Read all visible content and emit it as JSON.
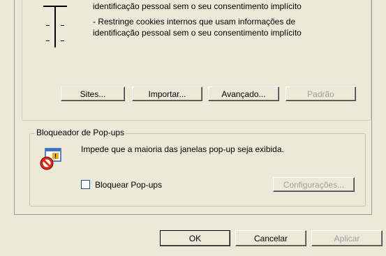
{
  "privacy": {
    "line1": "identificação pessoal sem o seu consentimento implícito",
    "line2": "- Restringe cookies internos que usam informações de",
    "line3": "identificação pessoal sem o seu consentimento implícito",
    "buttons": {
      "sites": "Sites...",
      "import": "Importar...",
      "advanced": "Avançado...",
      "default": "Padrão"
    }
  },
  "popup_blocker": {
    "title": "Bloqueador de Pop-ups",
    "description": "Impede que a maioria das janelas pop-up seja exibida.",
    "checkbox_label": "Bloquear Pop-ups",
    "checkbox_checked": false,
    "settings_label": "Configurações..."
  },
  "dialog": {
    "ok": "OK",
    "cancel": "Cancelar",
    "apply": "Aplicar"
  },
  "icons": {
    "popup_blocker": "popup-blocker-icon"
  }
}
